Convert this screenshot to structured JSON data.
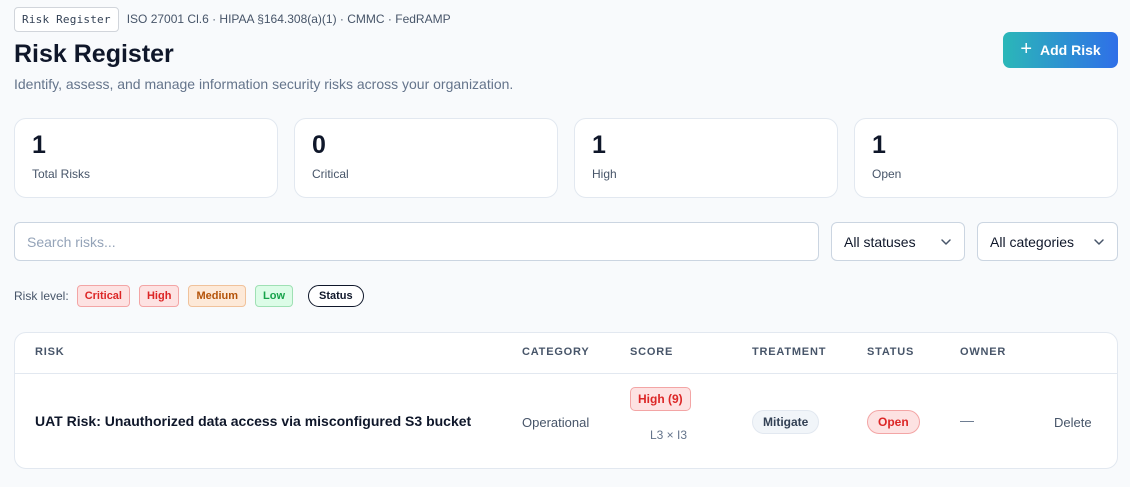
{
  "header": {
    "tag": "Risk Register",
    "compliance": "ISO 27001 Cl.6 · HIPAA §164.308(a)(1) · CMMC · FedRAMP",
    "title": "Risk Register",
    "subtitle": "Identify, assess, and manage information security risks across your organization.",
    "add_button": "Add Risk"
  },
  "stats": [
    {
      "value": "1",
      "label": "Total Risks"
    },
    {
      "value": "0",
      "label": "Critical"
    },
    {
      "value": "1",
      "label": "High"
    },
    {
      "value": "1",
      "label": "Open"
    }
  ],
  "filters": {
    "search_placeholder": "Search risks...",
    "status_select": "All statuses",
    "category_select": "All categories"
  },
  "legend": {
    "label": "Risk level:",
    "levels": [
      "Critical",
      "High",
      "Medium",
      "Low"
    ],
    "status": "Status"
  },
  "table": {
    "columns": [
      "RISK",
      "CATEGORY",
      "SCORE",
      "TREATMENT",
      "STATUS",
      "OWNER"
    ],
    "rows": [
      {
        "risk": "UAT Risk: Unauthorized data access via misconfigured S3 bucket",
        "category": "Operational",
        "score_badge": "High (9)",
        "score_detail": "L3 × I3",
        "treatment": "Mitigate",
        "status": "Open",
        "owner": "—",
        "action": "Delete"
      }
    ]
  },
  "colors": {
    "accent_start": "#2bb7b8",
    "accent_end": "#2f6fe8",
    "danger": "#dc2626",
    "warning": "#b45309",
    "success": "#16a34a"
  }
}
